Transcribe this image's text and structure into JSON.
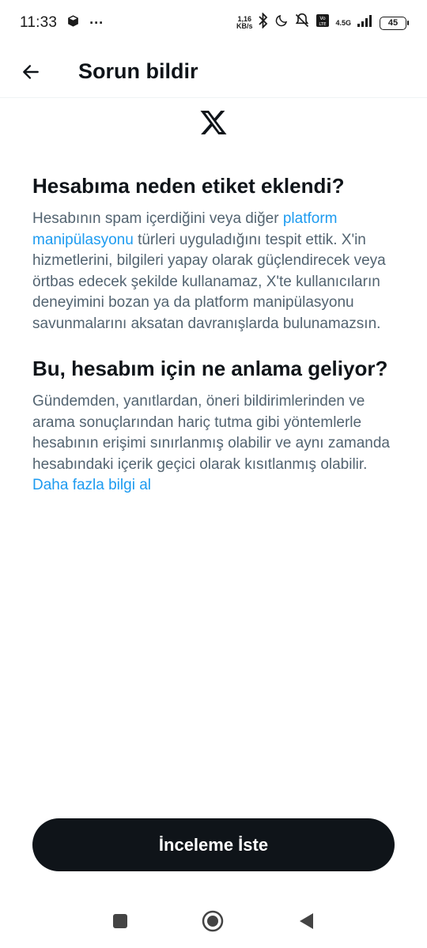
{
  "status_bar": {
    "time": "11:33",
    "more": "···",
    "speed_value": "1,16",
    "speed_unit": "KB/s",
    "network_type": "4.5G",
    "battery": "45"
  },
  "header": {
    "title": "Sorun bildir"
  },
  "logo": {
    "icon": "x-logo-icon"
  },
  "sections": [
    {
      "heading": "Hesabıma neden etiket eklendi?",
      "text_before_link": "Hesabının spam içerdiğini veya diğer ",
      "link": "platform manipülasyonu",
      "text_after_link": " türleri uyguladığını tespit ettik. X'in hizmetlerini, bilgileri yapay olarak güçlendirecek veya örtbas edecek şekilde kullanamaz, X'te kullanıcıların deneyimini bozan ya da platform manipülasyonu savunmalarını aksatan davranışlarda bulunamazsın."
    },
    {
      "heading": "Bu, hesabım için ne anlama geliyor?",
      "text_before_link": "Gündemden, yanıtlardan, öneri bildirimlerinden ve arama sonuçlarından hariç tutma gibi yöntemlerle hesabının erişimi sınırlanmış olabilir ve aynı zamanda hesabındaki içerik geçici olarak kısıtlanmış olabilir. ",
      "link": "Daha fazla bilgi al"
    }
  ],
  "cta": {
    "label": "İnceleme İste"
  },
  "colors": {
    "text_primary": "#0f1419",
    "text_secondary": "#536471",
    "link": "#1d9bf0",
    "button_bg": "#0f1419"
  }
}
